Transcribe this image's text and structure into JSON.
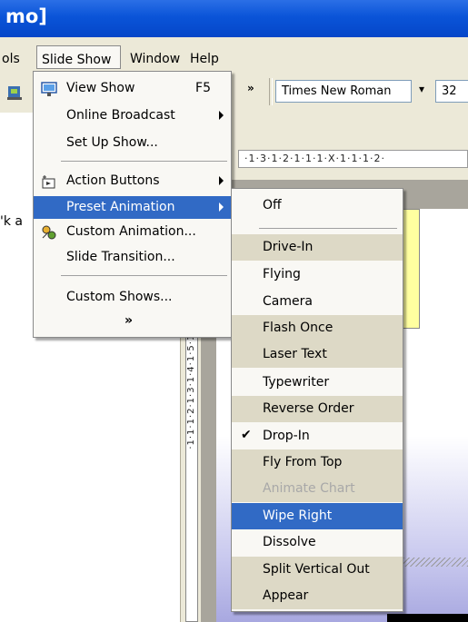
{
  "window": {
    "title_fragment": "mo]"
  },
  "menubar": {
    "items": [
      {
        "label": "ols"
      },
      {
        "label": "Slide Show"
      },
      {
        "label": "Window"
      },
      {
        "label": "Help"
      }
    ]
  },
  "toolbar": {
    "overflow": "»",
    "font_name": "Times New Roman",
    "font_size": "32",
    "dropdown": "▾"
  },
  "ruler": {
    "horizontal": "·1·3·1·2·1·1·1·X·1·1·1·2·",
    "vertical": "·1·1·1·2·1·3·1·4·1·5·1·6·"
  },
  "left_pane": {
    "text_fragment": "'k a"
  },
  "slide_show_menu": {
    "items": [
      {
        "label": "View Show",
        "shortcut": "F5",
        "icon": "view-show-icon"
      },
      {
        "label": "Online Broadcast",
        "submenu": true
      },
      {
        "label": "Set Up Show..."
      },
      {
        "label": "Action Buttons",
        "submenu": true,
        "icon": "action-buttons-icon"
      },
      {
        "label": "Preset Animation",
        "submenu": true,
        "highlighted": true
      },
      {
        "label": "Custom Animation...",
        "icon": "custom-animation-icon"
      },
      {
        "label": "Slide Transition..."
      },
      {
        "label": "Custom Shows..."
      },
      {
        "label": "»"
      }
    ]
  },
  "preset_animation_menu": {
    "items": [
      {
        "label": "Off"
      },
      {
        "label": "Drive-In"
      },
      {
        "label": "Flying"
      },
      {
        "label": "Camera"
      },
      {
        "label": "Flash Once"
      },
      {
        "label": "Laser Text"
      },
      {
        "label": "Typewriter"
      },
      {
        "label": "Reverse Order"
      },
      {
        "label": "Drop-In",
        "checked": true,
        "check": "✔"
      },
      {
        "label": "Fly From Top"
      },
      {
        "label": "Animate Chart",
        "disabled": true
      },
      {
        "label": "Wipe Right",
        "highlighted": true
      },
      {
        "label": "Dissolve"
      },
      {
        "label": "Split Vertical Out"
      },
      {
        "label": "Appear"
      }
    ]
  },
  "colors": {
    "title_bar": "#0a54d8",
    "highlight": "#316ac5",
    "menu_bg": "#f9f8f4",
    "band": "#ddd9c6",
    "chrome": "#ece9d8"
  }
}
